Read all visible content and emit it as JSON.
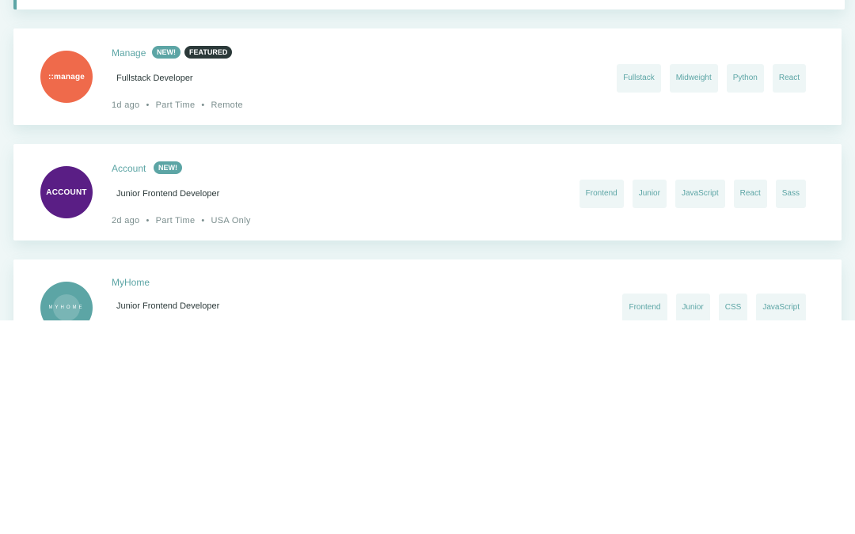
{
  "jobs": [
    {
      "company": "Manage",
      "logo_text": "::manage",
      "new_label": "NEW!",
      "featured_label": "FEATURED",
      "position": "Fullstack Developer",
      "posted": "1d ago",
      "contract": "Part Time",
      "location": "Remote",
      "tags": [
        "Fullstack",
        "Midweight",
        "Python",
        "React"
      ]
    },
    {
      "company": "Account",
      "logo_text": "ACCOUNT",
      "new_label": "NEW!",
      "position": "Junior Frontend Developer",
      "posted": "2d ago",
      "contract": "Part Time",
      "location": "USA Only",
      "tags": [
        "Frontend",
        "Junior",
        "JavaScript",
        "React",
        "Sass"
      ]
    },
    {
      "company": "MyHome",
      "logo_text": "MYHOME",
      "position": "Junior Frontend Developer",
      "tags": [
        "Frontend",
        "Junior",
        "CSS",
        "JavaScript"
      ]
    }
  ],
  "meta_separator": "•"
}
